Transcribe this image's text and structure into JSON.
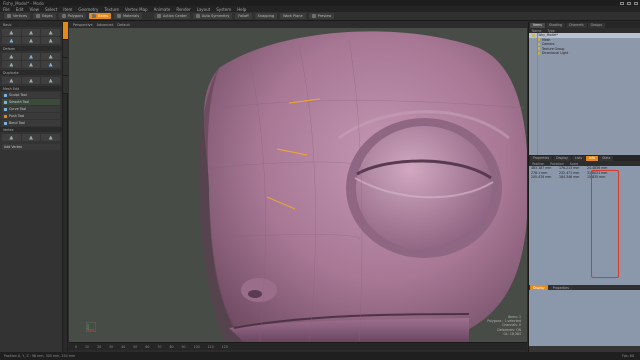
{
  "app": {
    "title": "Fishy_Model* - Modo"
  },
  "menu": [
    "File",
    "Edit",
    "View",
    "Select",
    "Item",
    "Geometry",
    "Texture",
    "Vertex Map",
    "Animate",
    "Render",
    "Layout",
    "System",
    "Help"
  ],
  "toolbar": {
    "buttons": [
      {
        "label": "Vertices",
        "active": false
      },
      {
        "label": "Edges",
        "active": false
      },
      {
        "label": "Polygons",
        "active": false
      },
      {
        "label": "Items",
        "active": true
      },
      {
        "label": "Materials",
        "active": false
      },
      {
        "label": "Action Center",
        "active": false
      },
      {
        "label": "Auto Symmetry",
        "active": false
      },
      {
        "label": "Falloff",
        "active": false
      },
      {
        "label": "Snapping",
        "active": false
      },
      {
        "label": "Work Plane",
        "active": false
      },
      {
        "label": "Preview",
        "active": false
      }
    ]
  },
  "toolbox": {
    "section_basic": "Basic",
    "section_deform": "Deform",
    "section_duplicate": "Duplicate",
    "section_mesh": "Mesh Edit",
    "section_vertex": "Vertex",
    "rows": [
      {
        "label": "Sculpt Tool",
        "style": "normal"
      },
      {
        "label": "Smooth Tool",
        "style": "green"
      },
      {
        "label": "Curve Tool",
        "style": "normal"
      },
      {
        "label": "Push Tool",
        "style": "orange"
      },
      {
        "label": "Bend Tool",
        "style": "normal"
      }
    ],
    "footer": "Add Vertex"
  },
  "viewport": {
    "tabs": [
      "Perspective",
      "Advanced",
      "Default"
    ],
    "info_lines": [
      "Items: 1",
      "Polygons : 1 selected",
      "Channels: 0",
      "Deformers: ON",
      "GL: 18,384"
    ]
  },
  "timeline": {
    "ticks": [
      "0",
      "10",
      "20",
      "30",
      "40",
      "50",
      "60",
      "70",
      "80",
      "90",
      "100",
      "110",
      "120"
    ]
  },
  "right_panel": {
    "tabs": [
      "Items",
      "Shading",
      "Channels",
      "Groups"
    ],
    "header": [
      "Name",
      "Type"
    ],
    "items": [
      {
        "label": "Fishy_Model*",
        "selected": true,
        "indent": 0
      },
      {
        "label": "Mesh",
        "selected": false,
        "indent": 1
      },
      {
        "label": "Camera",
        "selected": false,
        "indent": 1
      },
      {
        "label": "Texture Group",
        "selected": false,
        "indent": 1
      },
      {
        "label": "Directional Light",
        "selected": false,
        "indent": 1
      }
    ],
    "props_tabs": [
      "Properties",
      "Display",
      "Lists",
      "Info",
      "Stats"
    ],
    "props_header": [
      "Position",
      "Rotation",
      "Scale"
    ],
    "prop_rows": [
      [
        "483.187 mm",
        "176.213 mm",
        "24.4836 mm"
      ],
      [
        "278.1 mm",
        "232.471 mm",
        "31.8021 mm"
      ],
      [
        "205.476 mm",
        "184.346 mm",
        "15.835 mm"
      ]
    ],
    "bottom_tabs": [
      "Display",
      "Properties"
    ]
  },
  "status": {
    "left": "Position X, Y, Z : 96 mm, 305 mm, 254 mm",
    "right": "Fps: 60"
  }
}
